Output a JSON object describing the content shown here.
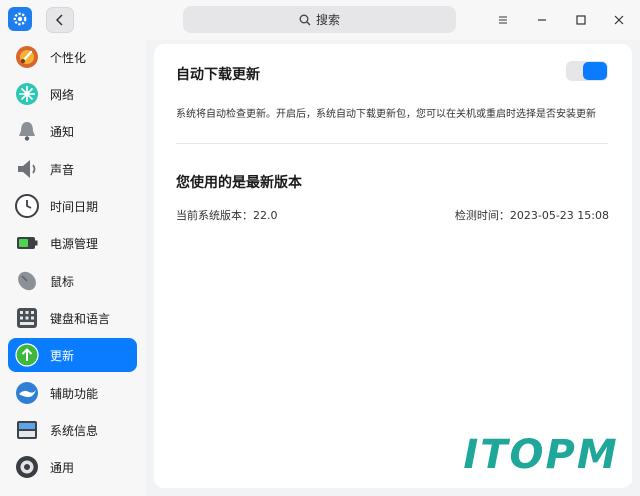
{
  "titlebar": {
    "search_placeholder": "搜索"
  },
  "sidebar": {
    "items": [
      {
        "label": "个性化",
        "icon": "personalization-icon"
      },
      {
        "label": "网络",
        "icon": "network-icon"
      },
      {
        "label": "通知",
        "icon": "bell-icon"
      },
      {
        "label": "声音",
        "icon": "speaker-icon"
      },
      {
        "label": "时间日期",
        "icon": "clock-icon"
      },
      {
        "label": "电源管理",
        "icon": "battery-icon"
      },
      {
        "label": "鼠标",
        "icon": "mouse-icon"
      },
      {
        "label": "键盘和语言",
        "icon": "keyboard-icon"
      },
      {
        "label": "更新",
        "icon": "update-icon",
        "active": true
      },
      {
        "label": "辅助功能",
        "icon": "accessibility-icon"
      },
      {
        "label": "系统信息",
        "icon": "system-info-icon"
      },
      {
        "label": "通用",
        "icon": "general-icon"
      }
    ]
  },
  "content": {
    "auto_update_title": "自动下载更新",
    "auto_update_enabled": true,
    "auto_update_desc": "系统将自动检查更新。开启后，系统自动下载更新包，您可以在关机或重启时选择是否安装更新",
    "status_title": "您使用的是最新版本",
    "current_version": "当前系统版本：22.0",
    "last_checked": "检测时间：2023-05-23 15:08"
  },
  "watermark": {
    "text": "ITOPM"
  },
  "colors": {
    "accent": "#0a7cff",
    "watermark": "#1fa79a"
  }
}
